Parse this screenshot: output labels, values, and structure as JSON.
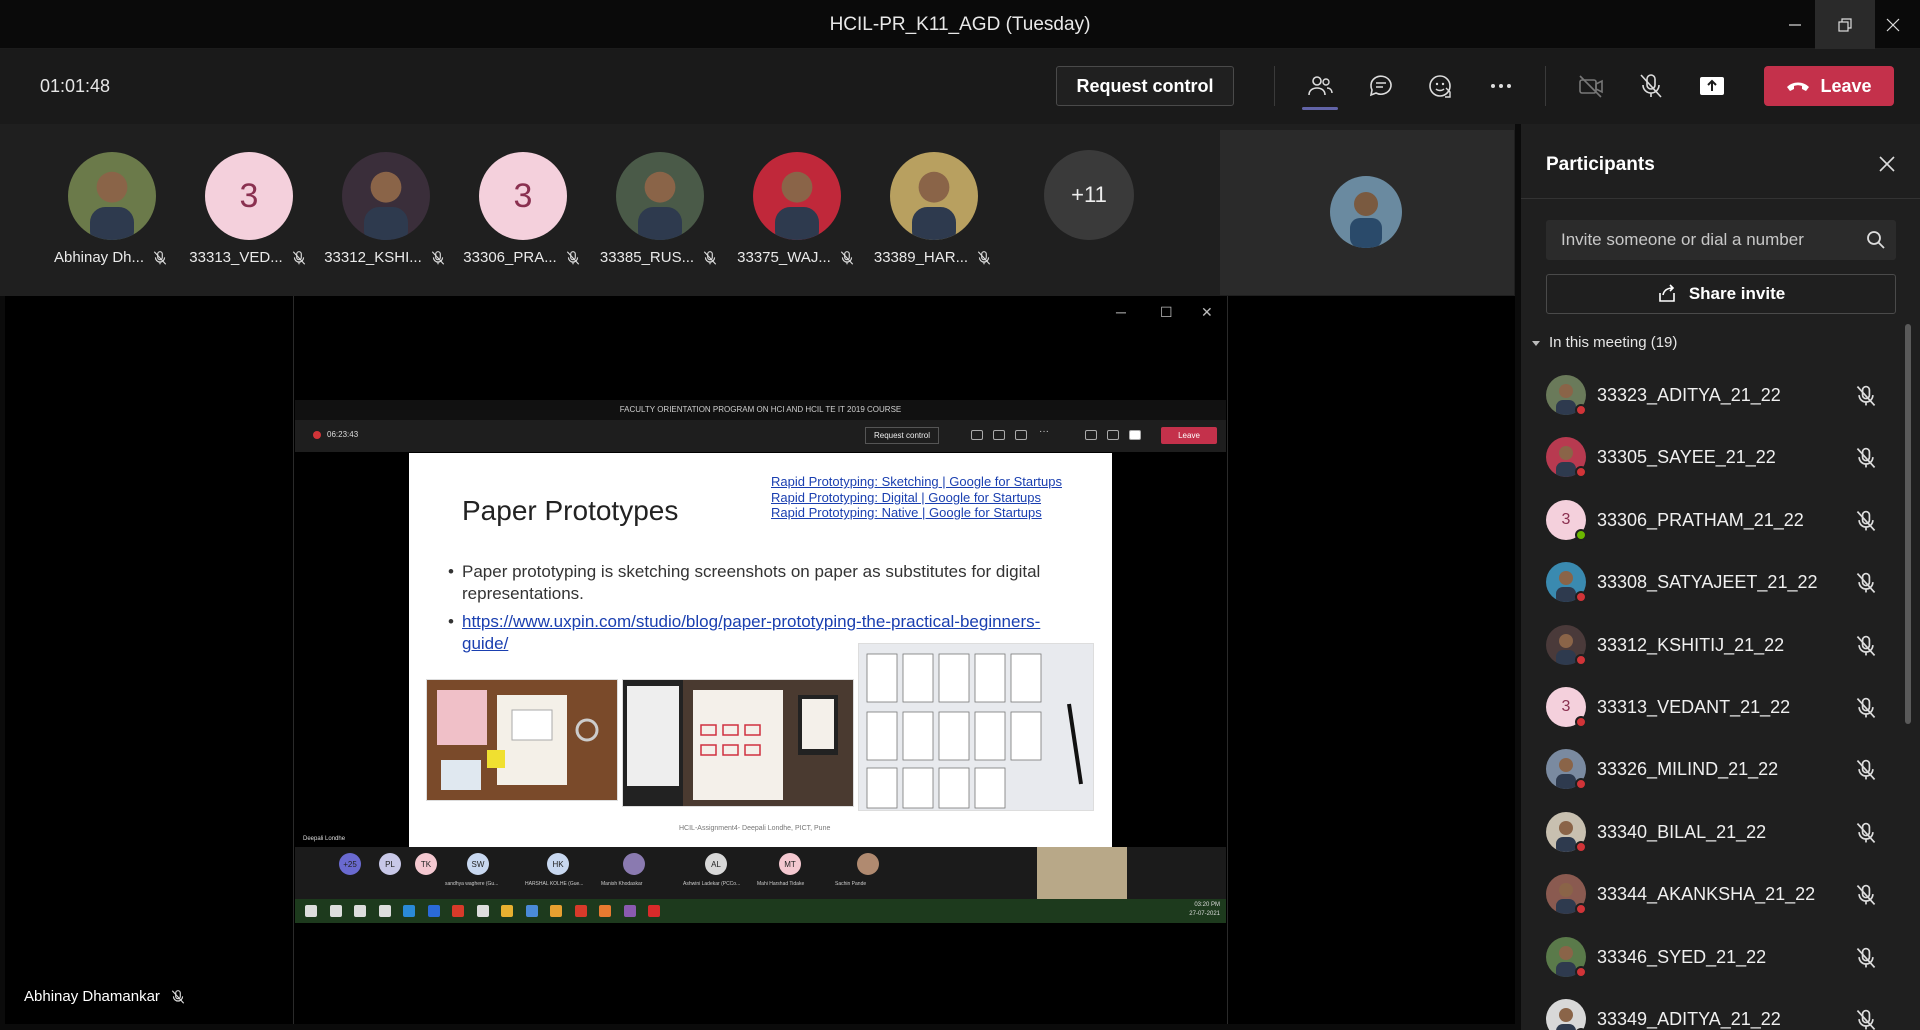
{
  "window": {
    "title": "HCIL-PR_K11_AGD (Tuesday)"
  },
  "meeting": {
    "timer": "01:01:48",
    "request_control_label": "Request control",
    "leave_label": "Leave"
  },
  "strip": {
    "participants": [
      {
        "name": "Abhinay Dh...",
        "avatar": "photo",
        "color": "#6b7a4a"
      },
      {
        "name": "33313_VED...",
        "avatar": "3",
        "color": "#f4d0dc"
      },
      {
        "name": "33312_KSHI...",
        "avatar": "photo",
        "color": "#3a2e3a"
      },
      {
        "name": "33306_PRA...",
        "avatar": "3",
        "color": "#f4d0dc"
      },
      {
        "name": "33385_RUS...",
        "avatar": "photo",
        "color": "#4a5a48"
      },
      {
        "name": "33375_WAJ...",
        "avatar": "photo",
        "color": "#c0283a"
      },
      {
        "name": "33389_HAR...",
        "avatar": "photo",
        "color": "#b8a060"
      }
    ],
    "more_count": "+11"
  },
  "stage": {
    "presenter_name": "Abhinay Dhamankar"
  },
  "shared_screen": {
    "window_title": "FACULTY ORIENTATION PROGRAM ON HCI AND HCIL TE IT 2019 COURSE",
    "timer": "06:23:43",
    "request_control_label": "Request control",
    "leave_label": "Leave",
    "presenter_label": "Deepali Londhe",
    "slide": {
      "title": "Paper Prototypes",
      "links": [
        "Rapid Prototyping: Sketching | Google for Startups",
        "Rapid Prototyping: Digital | Google for Startups",
        "Rapid Prototyping: Native | Google for Startups"
      ],
      "bullet1": "Paper prototyping is sketching screenshots on paper as substitutes for digital representations.",
      "bullet2_link": "https://www.uxpin.com/studio/blog/paper-prototyping-the-practical-beginners-guide/",
      "footer": "HCIL-Assignment4- Deepali Londhe, PICT, Pune"
    },
    "inner_participants": [
      {
        "initials": "+25",
        "name": "",
        "color": "#6a6ad0"
      },
      {
        "initials": "PL",
        "name": "",
        "color": "#c8c8e8"
      },
      {
        "initials": "TK",
        "name": "",
        "color": "#f4c8d0"
      },
      {
        "initials": "SW",
        "name": "sandhya waghere (Gu...",
        "color": "#c8d8f0"
      },
      {
        "initials": "HK",
        "name": "HARSHAL KOLHE (Gue...",
        "color": "#c8d8f0"
      },
      {
        "initials": "",
        "name": "Manish Khodaskar",
        "color": "#8a7ab0"
      },
      {
        "initials": "AL",
        "name": "Ashwini Ladekar (PCCo...",
        "color": "#d8d8d8"
      },
      {
        "initials": "MT",
        "name": "Mahi Harshad Tidake",
        "color": "#f4c8d0"
      },
      {
        "initials": "",
        "name": "Sachin Pande",
        "color": "#b08a70"
      }
    ],
    "taskbar_time": "03:20 PM",
    "taskbar_date": "27-07-2021"
  },
  "panel": {
    "title": "Participants",
    "invite_placeholder": "Invite someone or dial a number",
    "share_invite_label": "Share invite",
    "section_label": "In this meeting (19)",
    "participants": [
      {
        "name": "33323_ADITYA_21_22",
        "avatar": "photo",
        "color": "#6a7a5a",
        "status": "#d13438"
      },
      {
        "name": "33305_SAYEE_21_22",
        "avatar": "photo",
        "color": "#b83a50",
        "status": "#d13438"
      },
      {
        "name": "33306_PRATHAM_21_22",
        "avatar": "3",
        "color": "#f4d0dc",
        "status": "#6bb700"
      },
      {
        "name": "33308_SATYAJEET_21_22",
        "avatar": "photo",
        "color": "#3a8ab0",
        "status": "#d13438"
      },
      {
        "name": "33312_KSHITIJ_21_22",
        "avatar": "photo",
        "color": "#4a3a3a",
        "status": "#d13438"
      },
      {
        "name": "33313_VEDANT_21_22",
        "avatar": "3",
        "color": "#f4d0dc",
        "status": "#d13438"
      },
      {
        "name": "33326_MILIND_21_22",
        "avatar": "photo",
        "color": "#7a8aa0",
        "status": "#d13438"
      },
      {
        "name": "33340_BILAL_21_22",
        "avatar": "photo",
        "color": "#c8c0b0",
        "status": "#d13438"
      },
      {
        "name": "33344_AKANKSHA_21_22",
        "avatar": "photo",
        "color": "#8a5a50",
        "status": "#d13438"
      },
      {
        "name": "33346_SYED_21_22",
        "avatar": "photo",
        "color": "#5a7a4a",
        "status": "#d13438"
      },
      {
        "name": "33349_ADITYA_21_22",
        "avatar": "photo",
        "color": "#d8d8d8",
        "status": "#d13438"
      }
    ]
  },
  "colors": {
    "accent": "#6264a7",
    "leave": "#c4314b",
    "muted_red": "#d13438",
    "available": "#6bb700"
  }
}
